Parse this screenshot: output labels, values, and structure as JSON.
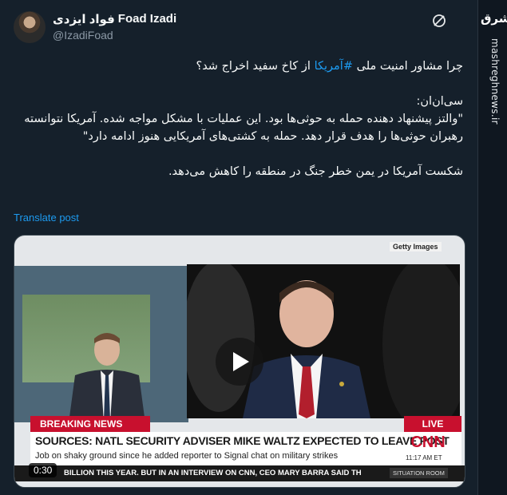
{
  "author": {
    "name_fa": "فواد ایزدی",
    "name_en": "Foad Izadi",
    "handle": "@IzadiFoad"
  },
  "brand": {
    "logo_text": "مشرق",
    "vertical_url": "mashreghnews.ir"
  },
  "tweet": {
    "line1_pre": "چرا مشاور امنیت ملی ",
    "hashtag": "#آمریکا",
    "line1_post": " از کاخ سفید اخراج شد؟",
    "para2_l1": "سی‌ان‌ان:",
    "para2_l2": "\"والتز پیشنهاد دهنده حمله به حوثی‌ها بود. این عملیات با مشکل مواجه شده. آمریکا نتوانسته رهبران حوثی‌ها را هدف قرار دهد. حمله به کشتی‌های آمریکایی هنوز ادامه دارد\"",
    "para3": "شکست آمریکا در یمن خطر جنگ در منطقه را کاهش می‌دهد."
  },
  "translate_label": "Translate post",
  "video": {
    "getty": "Getty Images",
    "breaking": "BREAKING NEWS",
    "live": "LIVE",
    "headline": "SOURCES: NATL SECURITY ADVISER MIKE WALTZ EXPECTED TO LEAVE POST",
    "subline": "Job on shaky ground since he added reporter to Signal chat on military strikes",
    "network": "CNN",
    "time": "11:17 AM ET",
    "ticker": "BILLION THIS YEAR. BUT IN AN INTERVIEW ON CNN, CEO MARY BARRA SAID TH",
    "situation": "SITUATION ROOM",
    "duration": "0:30"
  },
  "colors": {
    "background": "#15202b",
    "link": "#1d9bf0",
    "cnn_red": "#c8102e"
  }
}
